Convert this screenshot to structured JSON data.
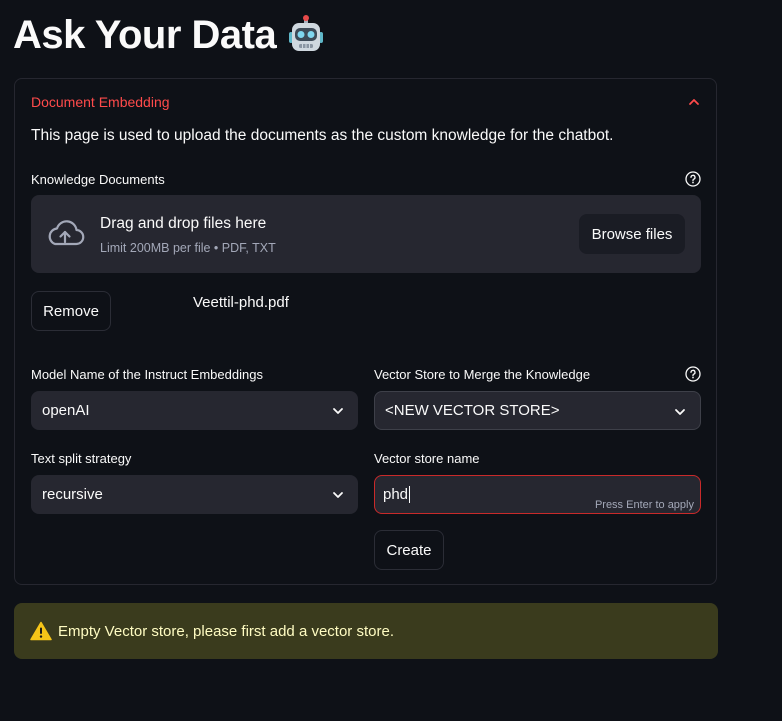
{
  "page": {
    "title": "Ask Your Data",
    "title_icon": "robot-icon"
  },
  "expander": {
    "title": "Document Embedding",
    "expanded": true,
    "description": "This page is used to upload the documents as the custom knowledge for the chatbot."
  },
  "uploader": {
    "label": "Knowledge Documents",
    "drop_text": "Drag and drop files here",
    "limit_text": "Limit 200MB per file • PDF, TXT",
    "browse_label": "Browse files",
    "icon": "cloud-upload-icon"
  },
  "uploaded": {
    "remove_label": "Remove",
    "filename": "Veettil-phd.pdf"
  },
  "form": {
    "model_label": "Model Name of the Instruct Embeddings",
    "model_value": "openAI",
    "vector_store_label": "Vector Store to Merge the Knowledge",
    "vector_store_value": "<NEW VECTOR STORE>",
    "split_label": "Text split strategy",
    "split_value": "recursive",
    "store_name_label": "Vector store name",
    "store_name_value": "phd",
    "press_enter_hint": "Press Enter to apply",
    "create_label": "Create"
  },
  "warning": {
    "text": "Empty Vector store, please first add a vector store.",
    "icon": "warning-icon"
  },
  "colors": {
    "background": "#0e1117",
    "accent": "#ff4b4b",
    "input_bg": "#262730",
    "warning_bg": "#3a3b1d",
    "warning_text": "#fffcc2",
    "error_border": "#c92a2a"
  }
}
